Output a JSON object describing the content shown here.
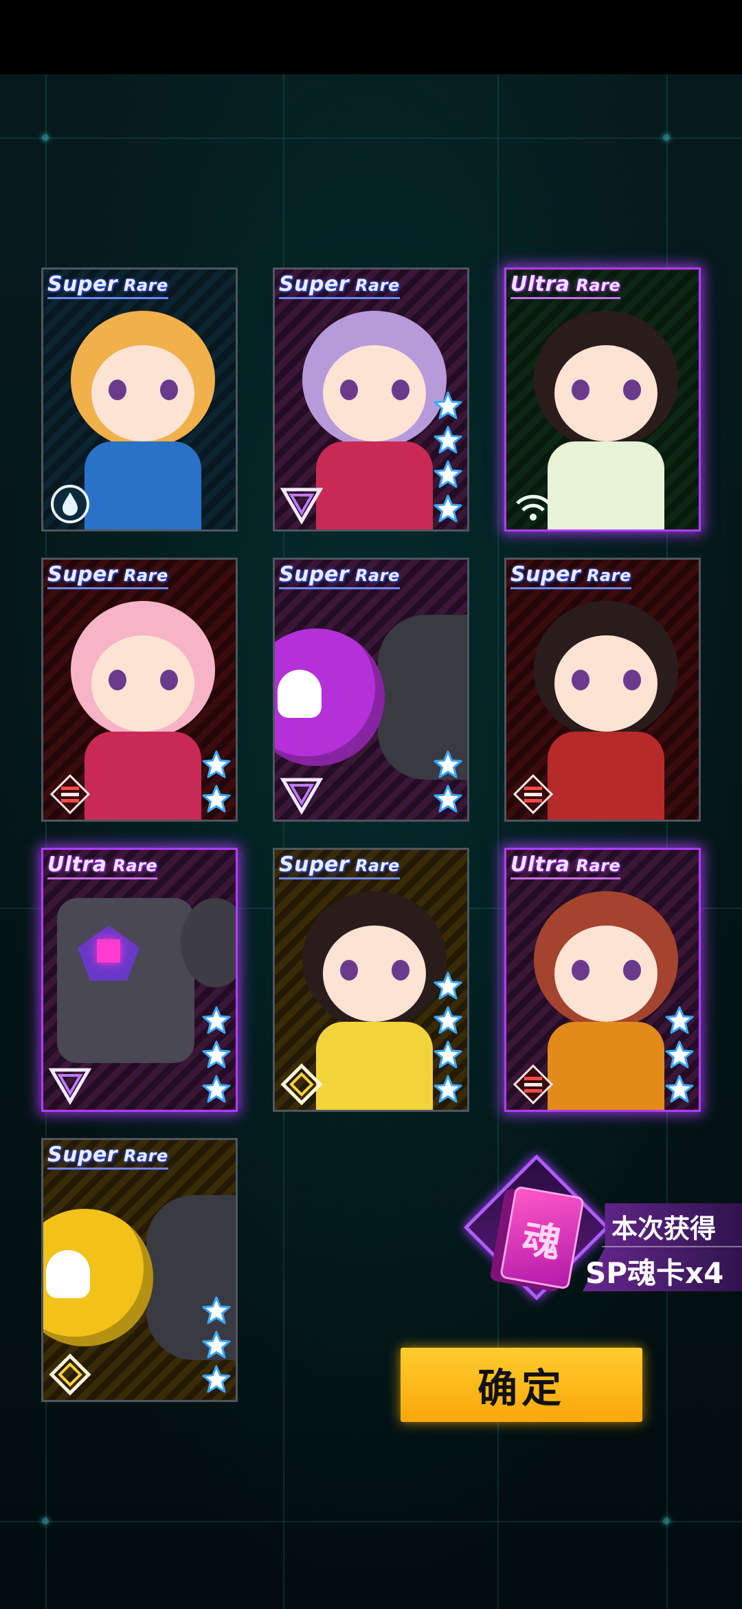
{
  "cards": [
    {
      "rarity_word": "Super",
      "rarity_tail": "Rare",
      "tier": "SR",
      "faction": "water-drop-icon",
      "stars": 0,
      "bg": "teal",
      "character": "Blonde fighter in blue suit"
    },
    {
      "rarity_word": "Super",
      "rarity_tail": "Rare",
      "tier": "SR",
      "faction": "triangle-icon",
      "stars": 4,
      "bg": "purple",
      "character": "Purple-haired girl with big cap"
    },
    {
      "rarity_word": "Ultra",
      "rarity_tail": "Rare",
      "tier": "UR",
      "faction": "wifi-icon",
      "stars": 0,
      "bg": "green",
      "character": "Dark-haired girl in white dress"
    },
    {
      "rarity_word": "Super",
      "rarity_tail": "Rare",
      "tier": "SR",
      "faction": "stripes-icon",
      "stars": 2,
      "bg": "red",
      "character": "Pink-haired laughing girl"
    },
    {
      "rarity_word": "Super",
      "rarity_tail": "Rare",
      "tier": "SR",
      "faction": "triangle-icon",
      "stars": 2,
      "bg": "purple",
      "character": "Purple bomb with skull"
    },
    {
      "rarity_word": "Super",
      "rarity_tail": "Rare",
      "tier": "SR",
      "faction": "stripes-icon",
      "stars": 0,
      "bg": "red",
      "character": "Black-haired girl in kimono"
    },
    {
      "rarity_word": "Ultra",
      "rarity_tail": "Rare",
      "tier": "UR",
      "faction": "triangle-icon",
      "stars": 3,
      "bg": "purple",
      "character": "Purple robot mech"
    },
    {
      "rarity_word": "Super",
      "rarity_tail": "Rare",
      "tier": "SR",
      "faction": "diamond-icon",
      "stars": 4,
      "bg": "gold",
      "character": "Girl with yellow cap"
    },
    {
      "rarity_word": "Ultra",
      "rarity_tail": "Rare",
      "tier": "UR",
      "faction": "stripes-icon",
      "stars": 3,
      "bg": "purple",
      "character": "Red-haired girl with gas mask"
    },
    {
      "rarity_word": "Super",
      "rarity_tail": "Rare",
      "tier": "SR",
      "faction": "diamond-icon",
      "stars": 3,
      "bg": "gold",
      "character": "Yellow bomb with skull"
    }
  ],
  "reward": {
    "card_glyph": "魂",
    "title": "本次获得",
    "value": "SP魂卡x4"
  },
  "confirm_label": "确定",
  "colors": {
    "ur_glow": "#b13cff",
    "sr_border": "#4e5660",
    "confirm": "#f9a70a",
    "star": "#ffffff"
  }
}
